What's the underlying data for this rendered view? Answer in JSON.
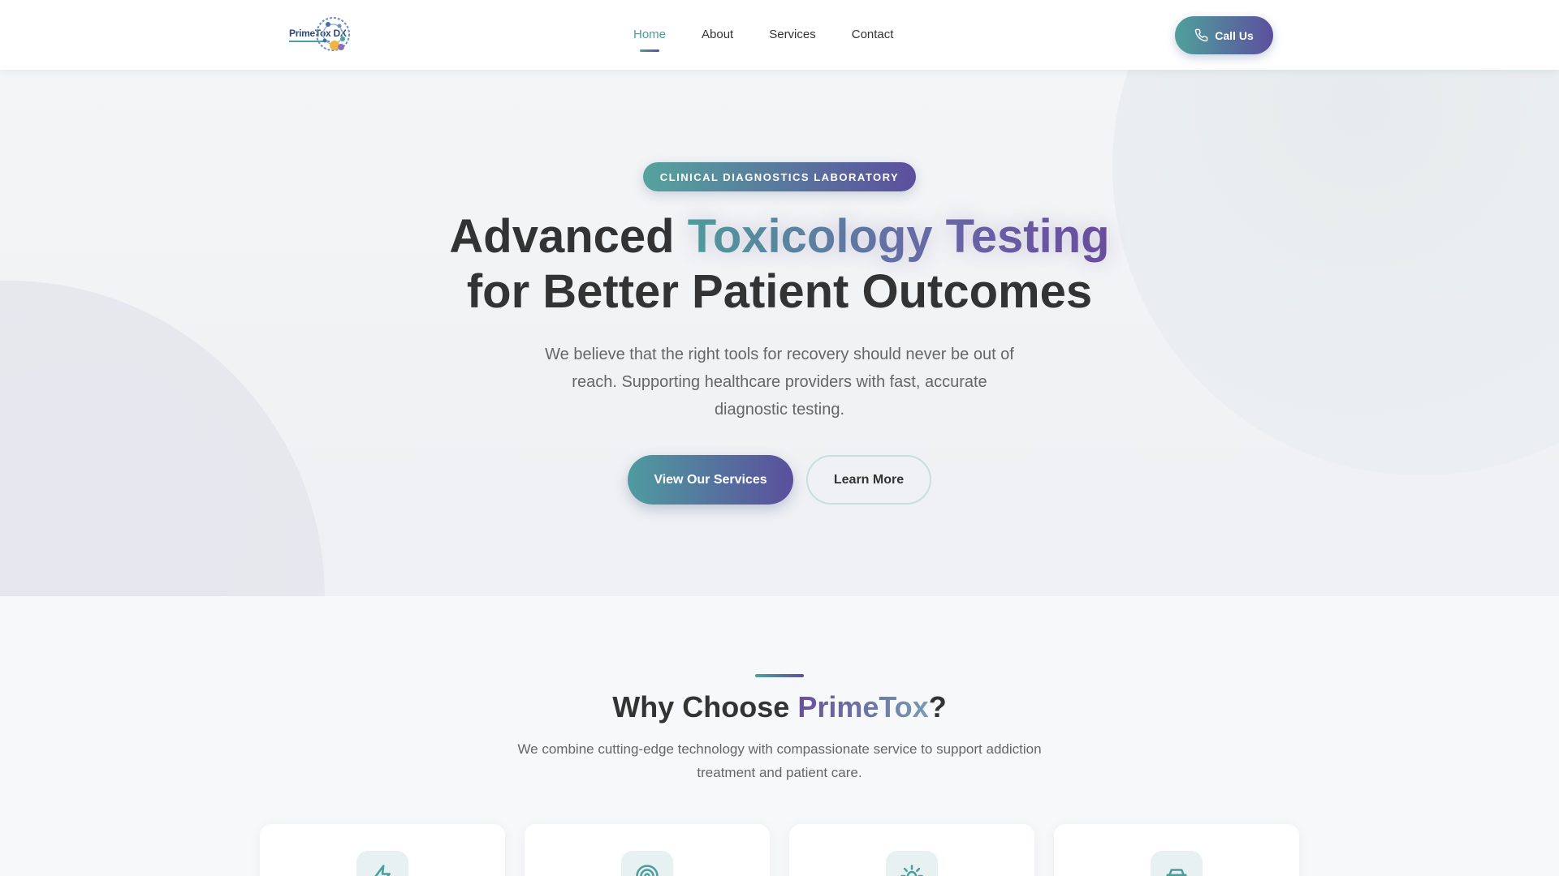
{
  "header": {
    "logo": {
      "text_main": "PrimeTox",
      "text_suffix": "DX"
    },
    "nav": [
      {
        "label": "Home",
        "active": true
      },
      {
        "label": "About",
        "active": false
      },
      {
        "label": "Services",
        "active": false
      },
      {
        "label": "Contact",
        "active": false
      }
    ],
    "call_button": {
      "label": "Call Us",
      "icon": "phone-icon"
    }
  },
  "hero": {
    "badge": "CLINICAL DIAGNOSTICS LABORATORY",
    "title_part1": "Advanced ",
    "title_highlight": "Toxicology Testing",
    "title_part2": "for Better Patient Outcomes",
    "subtitle": "We believe that the right tools for recovery should never be out of reach. Supporting healthcare providers with fast, accurate diagnostic testing.",
    "primary_button": "View Our Services",
    "secondary_button": "Learn More"
  },
  "why": {
    "title_part1": "Why Choose ",
    "title_highlight": "PrimeTox",
    "title_part2": "?",
    "subtitle": "We combine cutting-edge technology with compassionate service to support addiction treatment and patient care.",
    "cards": [
      {
        "icon": "lightning-icon"
      },
      {
        "icon": "target-icon"
      },
      {
        "icon": "sun-icon"
      },
      {
        "icon": "car-icon"
      }
    ]
  },
  "colors": {
    "teal": "#4fa19c",
    "purple": "#5c4f9e",
    "text_dark": "#333333",
    "text_muted": "#666666"
  }
}
